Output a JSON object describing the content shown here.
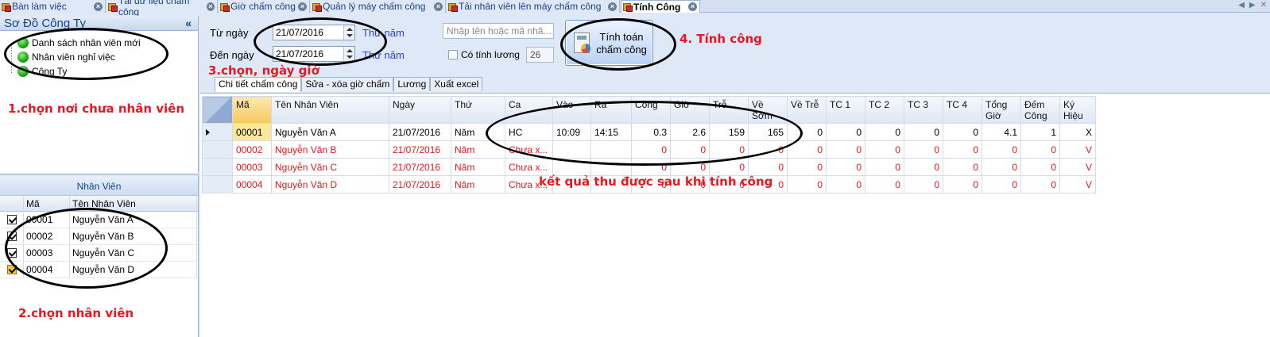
{
  "doc_tabs": [
    {
      "label": "Bàn làm việc",
      "active": false
    },
    {
      "label": "Tải dữ liệu chấm công",
      "active": false
    },
    {
      "label": "Giờ chấm công",
      "active": false
    },
    {
      "label": "Quản lý máy chấm công",
      "active": false
    },
    {
      "label": "Tải nhân viên lên máy chấm công",
      "active": false
    },
    {
      "label": "Tính Công",
      "active": true
    }
  ],
  "left_top": {
    "title": "Sơ Đồ Công Ty",
    "collapse": "«",
    "tree": [
      "Danh sách nhân viên mới",
      "Nhân viên nghỉ việc",
      "Công Ty"
    ]
  },
  "left_bottom": {
    "caption": "Nhân Viên",
    "columns": [
      "Mã",
      "Tên Nhân Viên"
    ],
    "rows": [
      {
        "ma": "00001",
        "ten": "Nguyễn Văn A",
        "checked": true
      },
      {
        "ma": "00002",
        "ten": "Nguyễn Văn B",
        "checked": true
      },
      {
        "ma": "00003",
        "ten": "Nguyễn Văn C",
        "checked": true
      },
      {
        "ma": "00004",
        "ten": "Nguyễn Văn D",
        "checked": true
      }
    ]
  },
  "filters": {
    "tu_ngay_label": "Từ ngày",
    "tu_ngay_value": "21/07/2016",
    "tu_ngay_thu": "Thứ năm",
    "den_ngay_label": "Đến ngày",
    "den_ngay_value": "21/07/2016",
    "den_ngay_thu": "Thứ năm",
    "search_placeholder": "Nhập tên hoặc mã nhâ...",
    "luong_label": "Có tính lương",
    "luong_value": "26",
    "calc_button_line1": "Tính toán",
    "calc_button_line2": "chấm công"
  },
  "sub_tabs": [
    "Chi tiết chấm công",
    "Sửa - xóa giờ chấm",
    "Lương",
    "Xuất excel"
  ],
  "grid": {
    "columns": [
      "Mã",
      "Tên Nhân Viên",
      "Ngày",
      "Thứ",
      "Ca",
      "Vào",
      "Ra",
      "Công",
      "Giờ",
      "Trễ",
      "Về Sớm",
      "Về Trễ",
      "TC 1",
      "TC 2",
      "TC 3",
      "TC 4",
      "Tổng Giờ",
      "Đếm Công",
      "Ký Hiệu"
    ],
    "rows": [
      [
        "00001",
        "Nguyễn Văn A",
        "21/07/2016",
        "Năm",
        "HC",
        "10:09",
        "14:15",
        "0.3",
        "2.6",
        "159",
        "165",
        "0",
        "0",
        "0",
        "0",
        "0",
        "4.1",
        "1",
        "X"
      ],
      [
        "00002",
        "Nguyễn Văn B",
        "21/07/2016",
        "Năm",
        "Chưa x...",
        "",
        "",
        "0",
        "0",
        "0",
        "0",
        "0",
        "0",
        "0",
        "0",
        "0",
        "0",
        "0",
        "V"
      ],
      [
        "00003",
        "Nguyễn Văn C",
        "21/07/2016",
        "Năm",
        "Chưa x...",
        "",
        "",
        "0",
        "0",
        "0",
        "0",
        "0",
        "0",
        "0",
        "0",
        "0",
        "0",
        "0",
        "V"
      ],
      [
        "00004",
        "Nguyễn Văn D",
        "21/07/2016",
        "Năm",
        "Chưa x...",
        "",
        "",
        "0",
        "0",
        "0",
        "0",
        "0",
        "0",
        "0",
        "0",
        "0",
        "0",
        "0",
        "V"
      ]
    ]
  },
  "annotations": {
    "a1": "1.chọn nơi chưa nhân viên",
    "a2": "2.chọn nhân viên",
    "a3": "3.chọn, ngày giờ",
    "a4": "4. Tính công",
    "a5": "kết quả thu được sau khi tính công"
  },
  "colors": {
    "accent": "#15428b",
    "annotation": "#e8181e",
    "chrome": "#dfe8f6"
  }
}
